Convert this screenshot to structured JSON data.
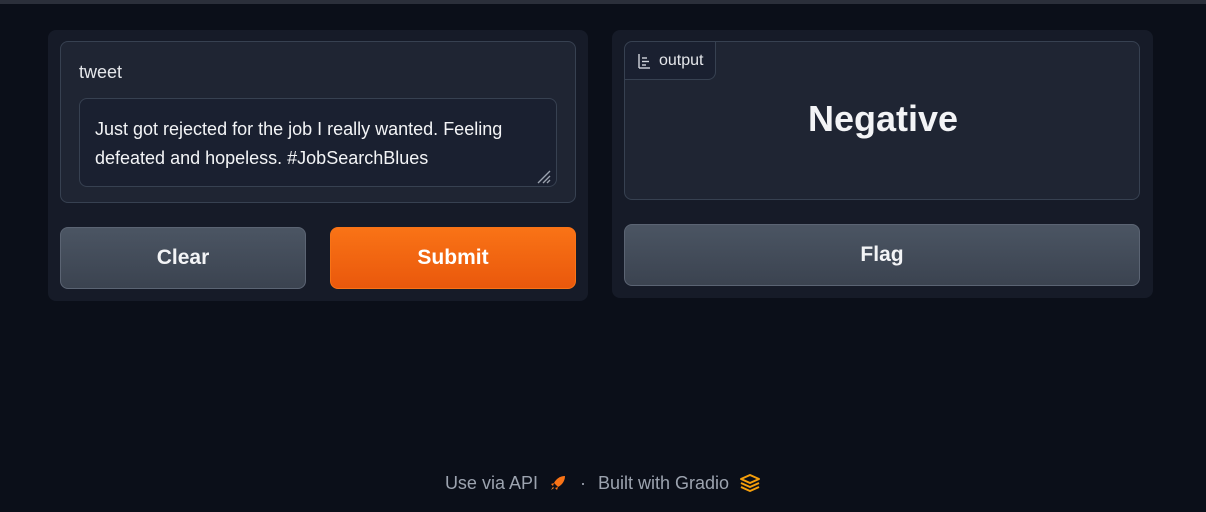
{
  "input": {
    "label": "tweet",
    "value": "Just got rejected for the job I really wanted. Feeling defeated and hopeless. #JobSearchBlues"
  },
  "buttons": {
    "clear": "Clear",
    "submit": "Submit",
    "flag": "Flag"
  },
  "output": {
    "tag_label": "output",
    "tag_icon": "label-icon",
    "value": "Negative"
  },
  "footer": {
    "api_label": "Use via API",
    "api_icon": "rocket-icon",
    "separator": "·",
    "built_label": "Built with Gradio",
    "built_icon": "gradio-logo-icon"
  },
  "colors": {
    "background": "#0b0f19",
    "panel": "#161b28",
    "primary": "#f97316",
    "secondary": "#4b5563"
  }
}
